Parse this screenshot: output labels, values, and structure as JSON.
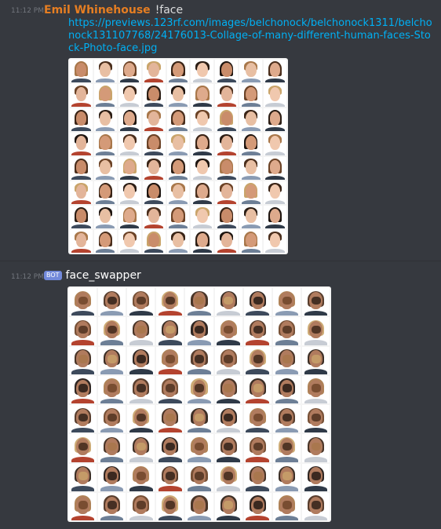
{
  "messages": [
    {
      "timestamp": "11:12 PM",
      "author": "Emil Whinehouse",
      "author_color": "#e67e22",
      "content": "!face",
      "link": "https://previews.123rf.com/images/belchonock/belchonock1311/belchonock131107768/24176013-Collage-of-many-different-human-faces-Stock-Photo-face.jpg",
      "image": {
        "description_icon": "face-collage-image",
        "rows": 8,
        "cols": 9
      }
    },
    {
      "timestamp": "11:12 PM",
      "bot_tag": "BOT",
      "author": "face_swapper",
      "image": {
        "description_icon": "face-swapped-collage-image",
        "rows": 8,
        "cols": 9
      }
    }
  ],
  "colors": {
    "background": "#36393f",
    "link": "#00b0f4",
    "bot_tag": "#7289da",
    "timestamp": "#72767d"
  }
}
